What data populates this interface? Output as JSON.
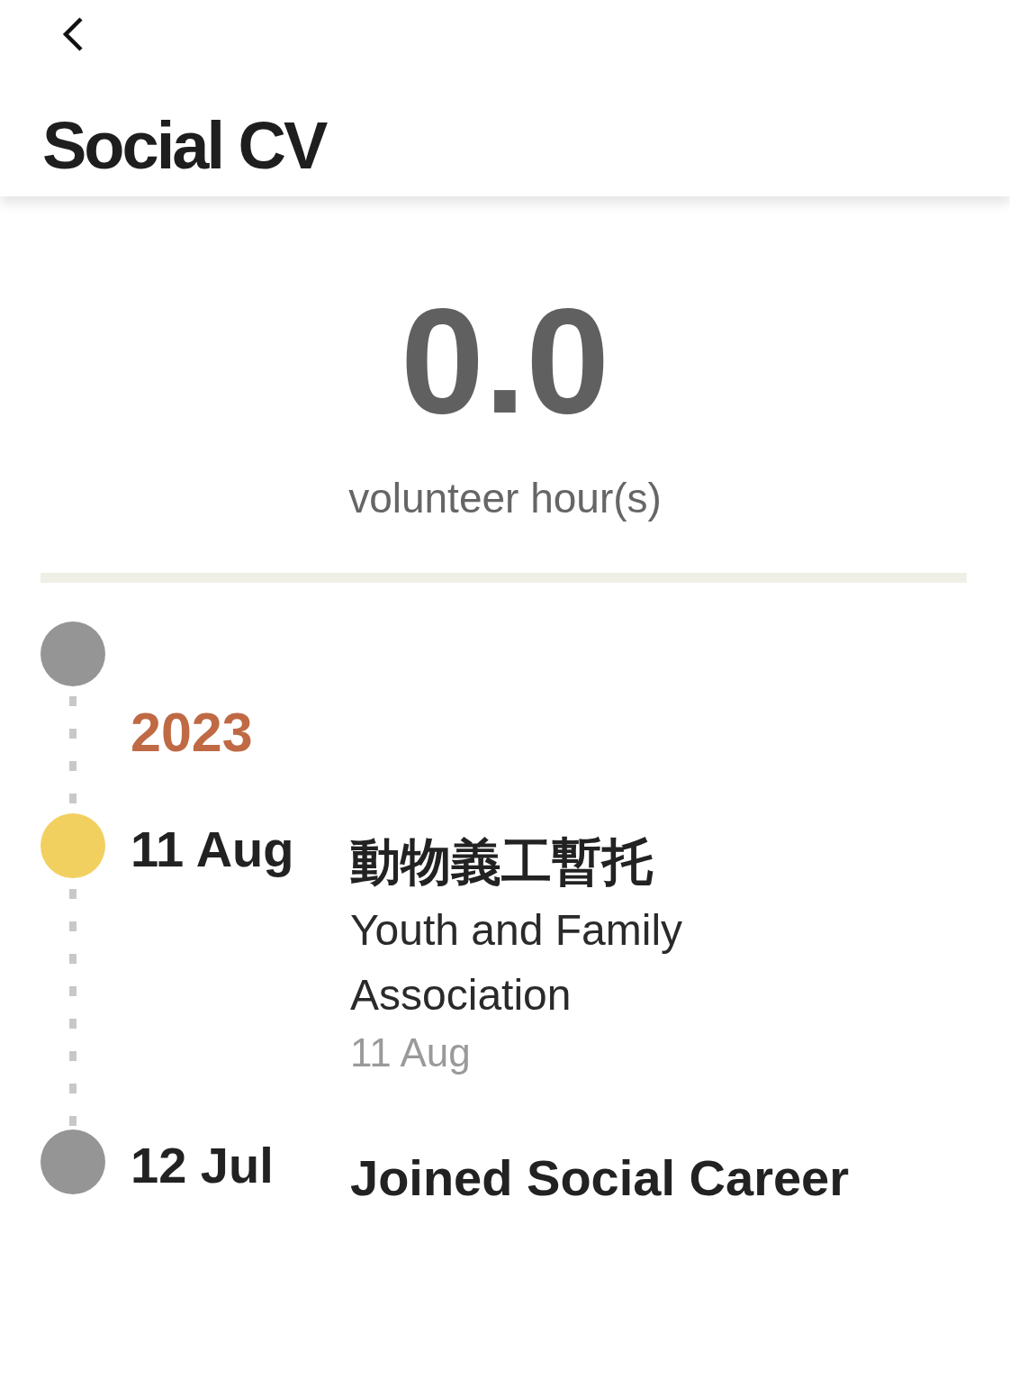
{
  "header": {
    "title": "Social CV"
  },
  "summary": {
    "hours": "0.0",
    "label": "volunteer hour(s)"
  },
  "timeline": [
    {
      "kind": "marker",
      "color": "#959595"
    },
    {
      "kind": "year",
      "label": "2023"
    },
    {
      "kind": "event",
      "date": "11 Aug",
      "title": "動物義工暫托",
      "organization": "Youth and Family Association",
      "time": "11 Aug",
      "color": "#f2d060"
    },
    {
      "kind": "event",
      "date": "12 Jul",
      "title": "Joined Social Career",
      "color": "#959595"
    }
  ]
}
